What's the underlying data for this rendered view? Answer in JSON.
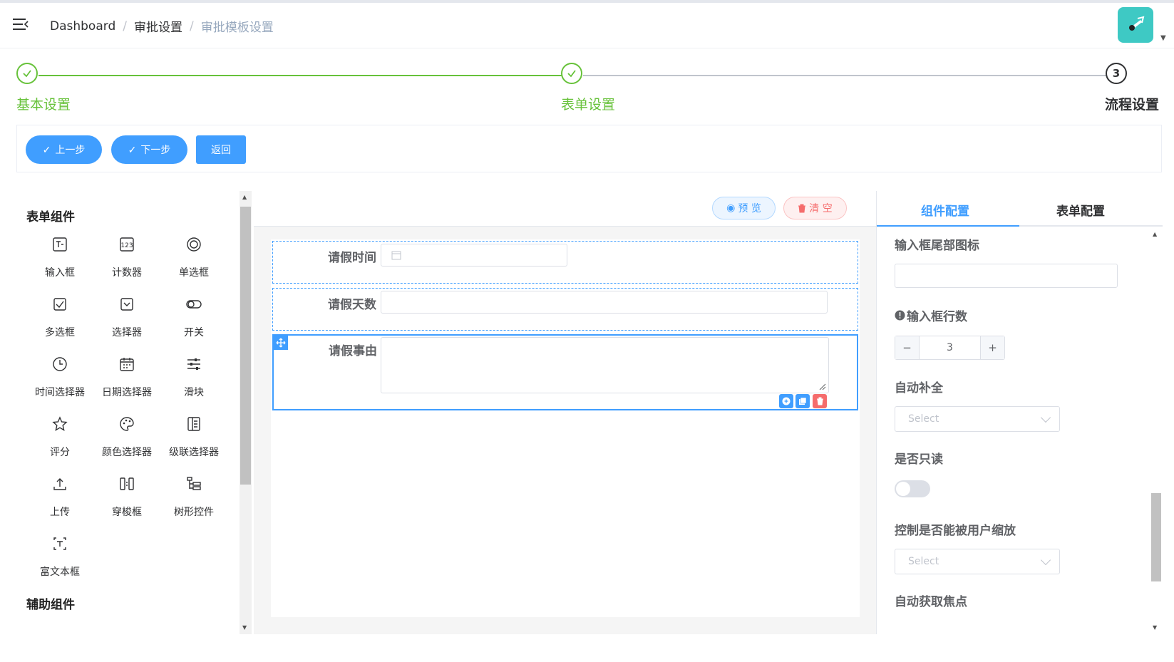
{
  "navbar": {
    "breadcrumb": [
      "Dashboard",
      "审批设置",
      "审批模板设置"
    ],
    "separator": "/"
  },
  "steps": [
    {
      "title": "基本设置",
      "status": "finished"
    },
    {
      "title": "表单设置",
      "status": "finished"
    },
    {
      "title": "流程设置",
      "number": "3",
      "status": "current"
    }
  ],
  "actions": {
    "prev": "上一步",
    "next": "下一步",
    "back": "返回"
  },
  "left_panel": {
    "section_form": "表单组件",
    "section_aux": "辅助组件",
    "components": [
      {
        "label": "输入框",
        "icon": "input-icon"
      },
      {
        "label": "计数器",
        "icon": "counter-icon"
      },
      {
        "label": "单选框",
        "icon": "radio-icon"
      },
      {
        "label": "多选框",
        "icon": "checkbox-icon"
      },
      {
        "label": "选择器",
        "icon": "select-icon"
      },
      {
        "label": "开关",
        "icon": "switch-icon"
      },
      {
        "label": "时间选择器",
        "icon": "clock-icon"
      },
      {
        "label": "日期选择器",
        "icon": "calendar-icon"
      },
      {
        "label": "滑块",
        "icon": "slider-icon"
      },
      {
        "label": "评分",
        "icon": "star-icon"
      },
      {
        "label": "颜色选择器",
        "icon": "palette-icon"
      },
      {
        "label": "级联选择器",
        "icon": "cascader-icon"
      },
      {
        "label": "上传",
        "icon": "upload-icon"
      },
      {
        "label": "穿梭框",
        "icon": "transfer-icon"
      },
      {
        "label": "树形控件",
        "icon": "tree-icon"
      },
      {
        "label": "富文本框",
        "icon": "richtext-icon"
      }
    ]
  },
  "center": {
    "preview": "预 览",
    "clear": "清 空",
    "fields": [
      {
        "label": "请假时间",
        "type": "date"
      },
      {
        "label": "请假天数",
        "type": "input"
      },
      {
        "label": "请假事由",
        "type": "textarea",
        "active": true
      }
    ]
  },
  "right_panel": {
    "tab_component": "组件配置",
    "tab_form": "表单配置",
    "suffix_icon_label": "输入框尾部图标",
    "rows_label": "输入框行数",
    "rows_value": "3",
    "stepper_minus": "−",
    "stepper_plus": "+",
    "autocomplete_label": "自动补全",
    "autocomplete_placeholder": "Select",
    "readonly_label": "是否只读",
    "readonly_value": false,
    "resize_label": "控制是否能被用户缩放",
    "resize_placeholder": "Select",
    "autofocus_label": "自动获取焦点"
  },
  "colors": {
    "primary": "#409eff",
    "success": "#67c23a",
    "danger": "#f56c6c"
  }
}
